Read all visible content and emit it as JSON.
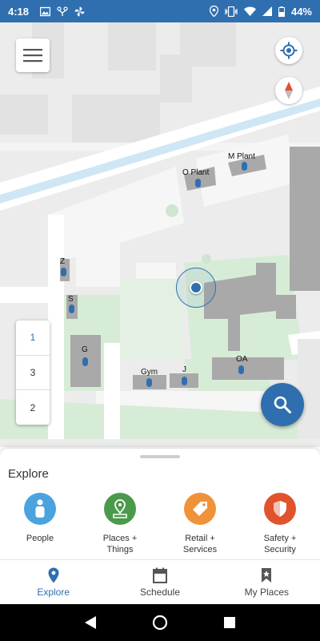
{
  "status_bar": {
    "time": "4:18",
    "battery": "44%",
    "icons": [
      "image-icon",
      "drone-icon",
      "fan-icon",
      "location-icon",
      "vibrate-icon",
      "wifi-icon",
      "signal-icon",
      "battery-icon"
    ]
  },
  "map": {
    "floors": [
      "1",
      "3",
      "2"
    ],
    "active_floor": "1",
    "labels": {
      "m_plant": "M Plant",
      "o_plant": "O Plant",
      "z": "Z",
      "s": "S",
      "g": "G",
      "gym": "Gym",
      "j": "J",
      "oa": "OA"
    },
    "colors": {
      "accent": "#2f6fb0",
      "water": "#cfe6f5",
      "grass": "#d7ecd7",
      "building": "#a9a9a9"
    }
  },
  "sheet": {
    "title": "Explore",
    "categories": [
      {
        "label": "People",
        "icon": "person-icon",
        "color": "#4aa3df"
      },
      {
        "label": "Places +\nThings",
        "icon": "map-pin-icon",
        "color": "#4a9a4a"
      },
      {
        "label": "Retail +\nServices",
        "icon": "tag-icon",
        "color": "#f0923a"
      },
      {
        "label": "Safety +\nSecurity",
        "icon": "shield-icon",
        "color": "#e0532c"
      }
    ]
  },
  "tabs": [
    {
      "label": "Explore",
      "icon": "location-pin-icon",
      "active": true
    },
    {
      "label": "Schedule",
      "icon": "calendar-icon",
      "active": false
    },
    {
      "label": "My Places",
      "icon": "bookmark-icon",
      "active": false
    }
  ]
}
